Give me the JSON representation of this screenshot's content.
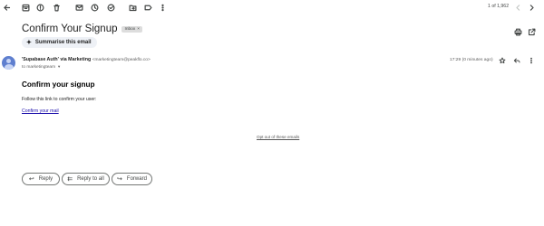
{
  "toolbar": {
    "icons": [
      "back-arrow-icon",
      "archive-icon",
      "report-spam-icon",
      "delete-icon",
      "mark-unread-icon",
      "snooze-icon",
      "add-task-icon",
      "move-to-icon",
      "label-icon",
      "more-vert-icon"
    ],
    "pager_text": "1 of 1,962",
    "prev_icon": "chevron-left-icon",
    "next_icon": "chevron-right-icon"
  },
  "email": {
    "subject": "Confirm Your Signup",
    "label": "Inbox",
    "label_remove": "×",
    "summarise_label": "Summarise this email",
    "sender_name": "'Supabase Auth' via Marketing",
    "sender_email": "<marketingteam@peakflo.co>",
    "to_line": "to marketingteam",
    "timestamp": "17:29 (0 minutes ago)",
    "body": {
      "heading": "Confirm your signup",
      "text": "Follow this link to confirm your user:",
      "link": "Confirm your mail",
      "optout": "Opt out of these emails"
    }
  },
  "actions": {
    "reply": "Reply",
    "reply_all": "Reply to all",
    "forward": "Forward"
  }
}
